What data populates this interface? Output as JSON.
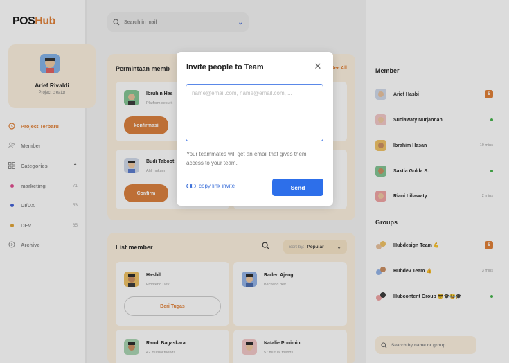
{
  "app": {
    "logo_main": "POS",
    "logo_accent": "Hub"
  },
  "profile": {
    "name": "Arief Rivaldi",
    "role": "Project creator"
  },
  "nav": {
    "project": "Project Terbaru",
    "member": "Member",
    "categories": "Categories",
    "categories_items": [
      {
        "label": "marketing",
        "count": "71",
        "color": "#e0458a"
      },
      {
        "label": "UI/UX",
        "count": "53",
        "color": "#3a5bd6"
      },
      {
        "label": "DEV",
        "count": "65",
        "color": "#e0a02e"
      }
    ],
    "archive": "Archive"
  },
  "topbar": {
    "search_placeholder": "Search in mail"
  },
  "requests": {
    "title": "Permintaan memb",
    "see_all": "See All",
    "cards": [
      {
        "name": "Ibruhin Has",
        "sub": "Platform securit",
        "button": "konfirmasi"
      },
      {
        "name": "Budi Taboot",
        "sub": "Ahli hukum",
        "button": "Confirm"
      }
    ]
  },
  "list_member": {
    "title": "List member",
    "sort_label": "Sort by:",
    "sort_value": "Popular",
    "cards": [
      {
        "name": "Hasbil",
        "sub": "Frontend Dev",
        "button": "Beri Tugas"
      },
      {
        "name": "Raden Ajeng",
        "sub": "Backend dev"
      },
      {
        "name": "Randi Bagaskara",
        "sub": "42 mutual friends"
      },
      {
        "name": "Natalie Ponimin",
        "sub": "57 mutual friends"
      }
    ]
  },
  "right": {
    "member_title": "Member",
    "members": [
      {
        "name": "Arief Hasbi",
        "status": "badge",
        "value": "5"
      },
      {
        "name": "Suciawaty Nurjannah",
        "status": "online"
      },
      {
        "name": "Ibrahim Hasan",
        "status": "time",
        "value": "10 mins"
      },
      {
        "name": "Saktia Golda S.",
        "status": "online"
      },
      {
        "name": "Riani Liliawaty",
        "status": "time",
        "value": "2 mins"
      }
    ],
    "groups_title": "Groups",
    "groups": [
      {
        "name": "Hubdesign Team 💪",
        "status": "badge",
        "value": "5"
      },
      {
        "name": "Hubdev Team 👍",
        "status": "time",
        "value": "3 mins"
      },
      {
        "name": "Hubcontent Group 😎🎓😂🎓",
        "status": "online"
      }
    ],
    "search_placeholder": "Search by name or group"
  },
  "modal": {
    "title": "Invite people to Team",
    "input_placeholder": "name@email.com, name@email.com, ...",
    "description": "Your teammates will get an email that gives them access to your team.",
    "copy_link": "copy link invite",
    "send": "Send"
  },
  "colors": {
    "accent": "#e07b2e",
    "primary": "#2d6fea",
    "panel": "#fdf1df"
  }
}
